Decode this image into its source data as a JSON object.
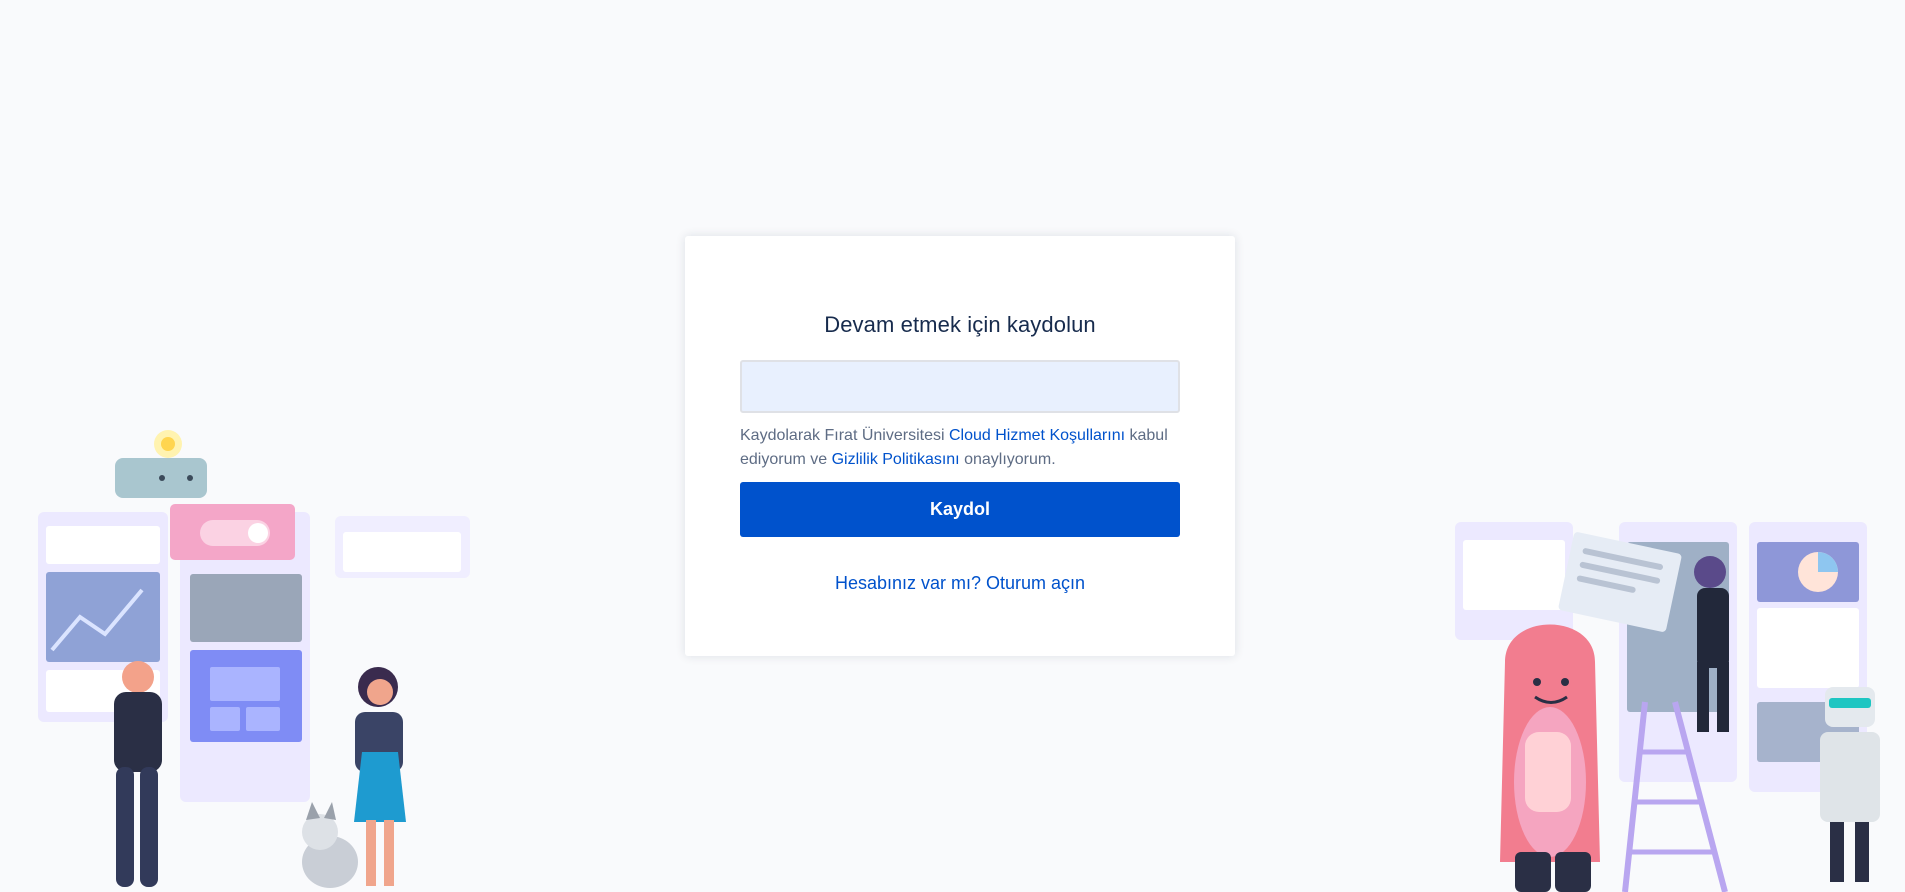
{
  "signup": {
    "title": "Devam etmek için kaydolun",
    "email_value": "",
    "email_placeholder": "",
    "legal": {
      "prefix": "Kaydolarak Fırat Üniversitesi ",
      "terms_link": "Cloud Hizmet Koşullarını",
      "middle": " kabul ediyorum ve ",
      "privacy_link": "Gizlilik Politikasını",
      "suffix": " onaylıyorum."
    },
    "submit_label": "Kaydol",
    "login_link": "Hesabınız var mı? Oturum açın"
  },
  "colors": {
    "background": "#f9fafc",
    "primary": "#0052cc",
    "title": "#172b4d",
    "muted_text": "#5e6c84",
    "input_fill": "#e8f0fe"
  },
  "illustrations": {
    "left": "team-collaboration-board-illustration",
    "right": "team-building-board-illustration"
  }
}
